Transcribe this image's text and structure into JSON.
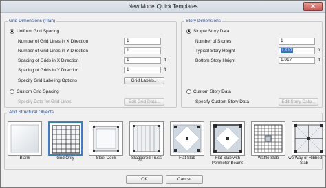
{
  "window": {
    "title": "New Model Quick Templates",
    "close_glyph": "✕"
  },
  "grid": {
    "legend": "Grid Dimensions (Plan)",
    "uniform_label": "Uniform Grid Spacing",
    "fields": [
      {
        "label": "Number of Grid Lines in X Direction",
        "value": "1",
        "unit": ""
      },
      {
        "label": "Number of Grid Lines in Y Direction",
        "value": "1",
        "unit": ""
      },
      {
        "label": "Spacing of Grids in X Direction",
        "value": "1",
        "unit": "ft"
      },
      {
        "label": "Spacing of Grids in Y Direction",
        "value": "1",
        "unit": "ft"
      }
    ],
    "labeling_options_label": "Specify Grid Labeling Options",
    "grid_labels_button": "Grid Labels...",
    "custom_label": "Custom Grid Spacing",
    "custom_data_label": "Specify Data for Grid Lines",
    "edit_grid_button": "Edit Grid Data..."
  },
  "story": {
    "legend": "Story Dimensions",
    "simple_label": "Simple Story Data",
    "fields": [
      {
        "label": "Number of Stories",
        "value": "1",
        "unit": ""
      },
      {
        "label": "Typical Story Height",
        "value": "1.917",
        "unit": "ft"
      },
      {
        "label": "Bottom Story Height",
        "value": "1.917",
        "unit": "ft"
      }
    ],
    "custom_label": "Custom Story Data",
    "custom_data_label": "Specify Custom Story Data",
    "edit_story_button": "Edit Story Data..."
  },
  "objects": {
    "legend": "Add Structural Objects",
    "items": [
      {
        "label": "Blank",
        "icon": "blank-icon"
      },
      {
        "label": "Grid Only",
        "icon": "grid-only-icon"
      },
      {
        "label": "Steel Deck",
        "icon": "steel-deck-icon"
      },
      {
        "label": "Staggered Truss",
        "icon": "staggered-truss-icon"
      },
      {
        "label": "Flat Slab",
        "icon": "flat-slab-icon"
      },
      {
        "label": "Flat Slab with Perimeter Beams",
        "icon": "flat-slab-beams-icon"
      },
      {
        "label": "Waffle Slab",
        "icon": "waffle-slab-icon"
      },
      {
        "label": "Two Way or Ribbed Slab",
        "icon": "two-way-slab-icon"
      }
    ],
    "selected": "Grid Only"
  },
  "footer": {
    "ok_label": "OK",
    "cancel_label": "Cancel"
  }
}
